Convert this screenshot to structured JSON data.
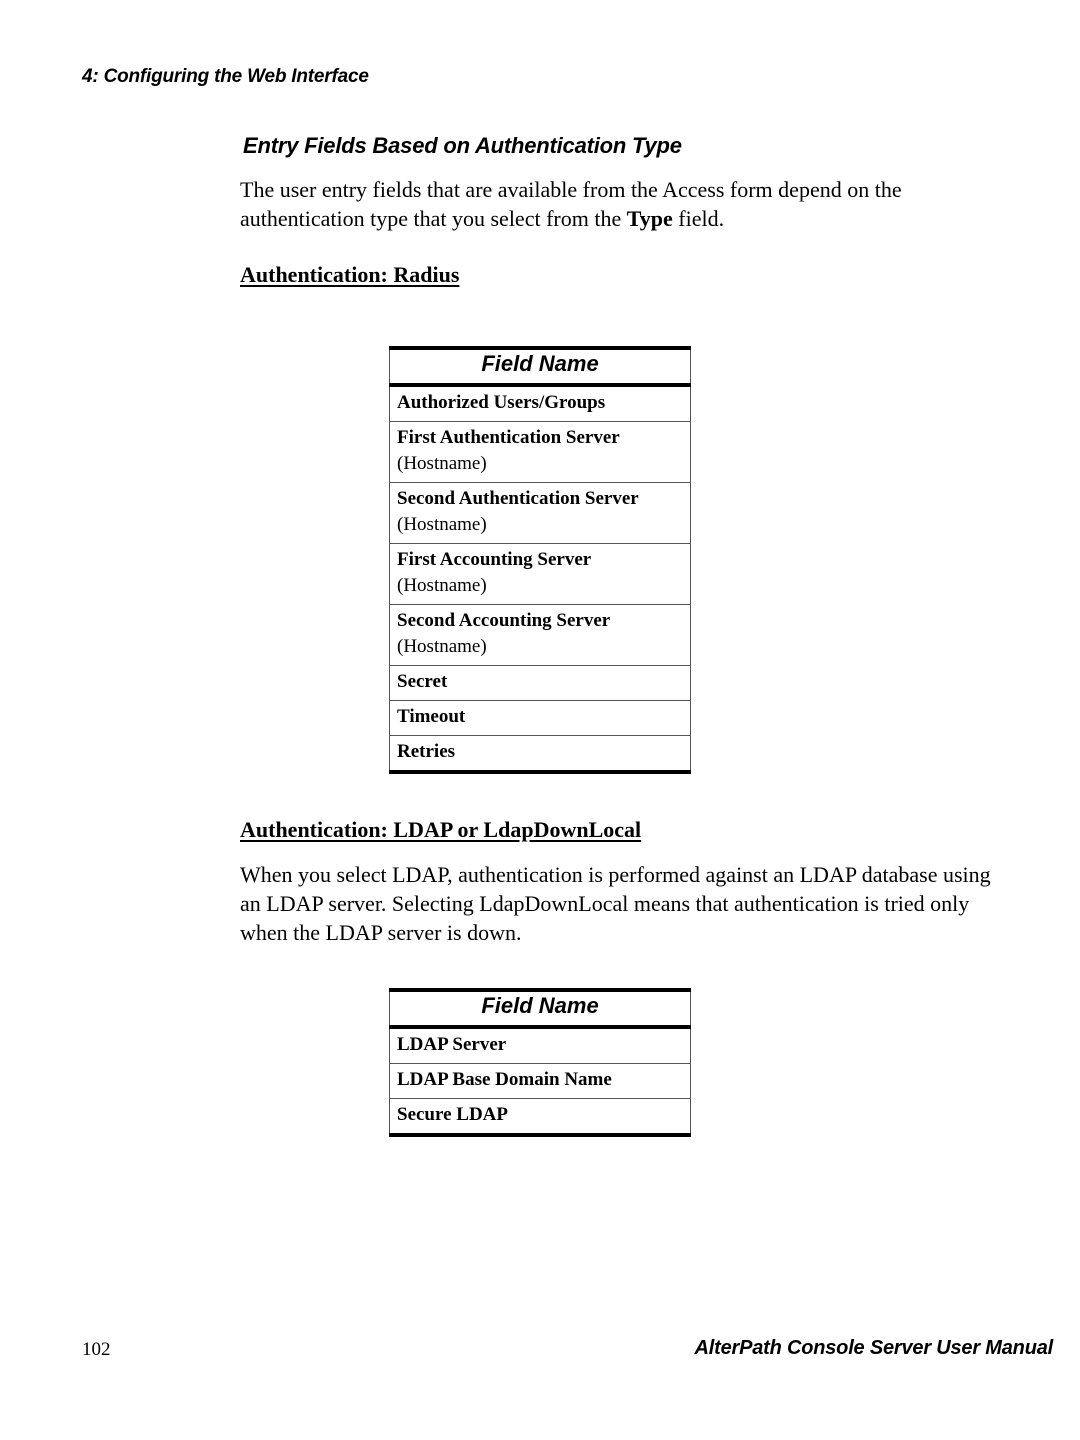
{
  "header": {
    "running_head": "4: Configuring the Web Interface"
  },
  "section": {
    "title": "Entry Fields Based on Authentication Type",
    "intro_before_bold": "The user entry fields that are available from the Access form depend on the authentication type that you select from the ",
    "intro_bold": "Type",
    "intro_after_bold": " field."
  },
  "radius": {
    "heading": "Authentication: Radius",
    "table": {
      "header": "Field Name",
      "rows": [
        {
          "name": "Authorized Users/Groups",
          "note": ""
        },
        {
          "name": "First Authentication Server",
          "note": "(Hostname)"
        },
        {
          "name": "Second Authentication Server",
          "note": "(Hostname)"
        },
        {
          "name": "First Accounting Server",
          "note": "(Hostname)"
        },
        {
          "name": "Second Accounting Server",
          "note": "(Hostname)"
        },
        {
          "name": "Secret",
          "note": ""
        },
        {
          "name": "Timeout",
          "note": ""
        },
        {
          "name": "Retries",
          "note": ""
        }
      ]
    }
  },
  "ldap": {
    "heading": "Authentication: LDAP or LdapDownLocal",
    "paragraph": "When you select LDAP, authentication is performed against an LDAP database using an LDAP server. Selecting LdapDownLocal means that authentication is tried only when the LDAP server is down.",
    "table": {
      "header": "Field Name",
      "rows": [
        {
          "name": "LDAP Server"
        },
        {
          "name": "LDAP Base Domain Name"
        },
        {
          "name": "Secure LDAP"
        }
      ]
    }
  },
  "footer": {
    "page_number": "102",
    "book_title": "AlterPath Console Server User Manual"
  }
}
